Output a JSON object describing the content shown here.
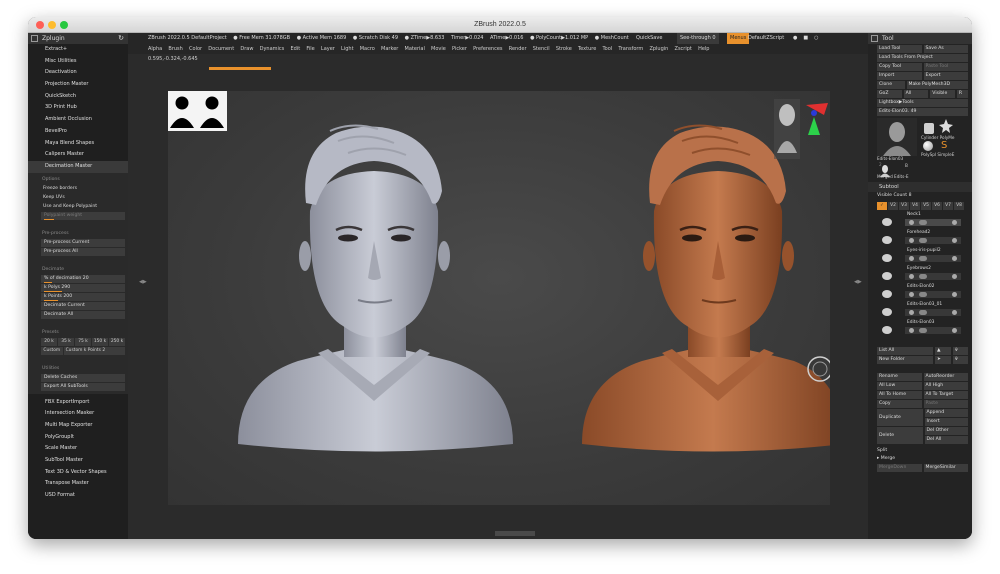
{
  "window": {
    "title": "ZBrush 2022.0.5"
  },
  "topinfo": {
    "project": "ZBrush 2022.0.5 DefaultProject",
    "free_mem": "● Free Mem 31.078GB",
    "active_mem": "● Active Mem 1689",
    "scratch_disk": "● Scratch Disk 49",
    "ztime": "● ZTime▶8.633",
    "timer": "Timer▶0.024",
    "atime": "ATime▶0.016",
    "polycount": "● PolyCount▶1.012 MP",
    "meshcount": "● MeshCount",
    "quicksave": "QuickSave",
    "see_through": "See-through 0",
    "menus": "Menus",
    "zscript": "DefaultZScript"
  },
  "menubar": [
    "Alpha",
    "Brush",
    "Color",
    "Document",
    "Draw",
    "Dynamics",
    "Edit",
    "File",
    "Layer",
    "Light",
    "Macro",
    "Marker",
    "Material",
    "Movie",
    "Picker",
    "Preferences",
    "Render",
    "Stencil",
    "Stroke",
    "Texture",
    "Tool",
    "Transform",
    "Zplugin",
    "Zscript",
    "Help"
  ],
  "coords": "0.595,-0.324,-0.645",
  "left_panel": {
    "title": "Zplugin",
    "items_top": [
      "Extract+",
      "Misc Utilities",
      "Deactivation",
      "Projection Master",
      "QuickSketch",
      "3D Print Hub",
      "Ambient Occlusion",
      "BevelPro",
      "Maya Blend Shapes",
      "Calipers Master",
      "Decimation Master"
    ],
    "decimation": {
      "options_head": "Options",
      "freeze_borders": "Freeze borders",
      "keep_uvs": "Keep UVs",
      "use_keep_polypaint": "Use and Keep Polypaint",
      "polypaint_weight": "Polypaint weight",
      "preprocess_head": "Pre-process",
      "preprocess_current": "Pre-process Current",
      "preprocess_all": "Pre-process All",
      "decimate_head": "Decimate",
      "pct_decimation": "% of decimation 20",
      "k_polys": "k Polys 290",
      "k_points": "k Points 200",
      "decimate_current": "Decimate Current",
      "decimate_all": "Decimate All",
      "presets_head": "Presets",
      "kpolys": [
        "20 k",
        "35 k",
        "75 k",
        "150 k",
        "250 k"
      ],
      "custom": "Custom",
      "custom_kpoints": "Custom k Points 2",
      "utilities_head": "Utilities",
      "delete_caches": "Delete Caches",
      "export_all": "Export All SubTools"
    },
    "items_bottom": [
      "FBX ExportImport",
      "Intersection Masker",
      "Multi Map Exporter",
      "PolyGroupIt",
      "Scale Master",
      "SubTool Master",
      "Text 3D & Vector Shapes",
      "Transpose Master",
      "USD Format"
    ]
  },
  "right_panel": {
    "title": "Tool",
    "load_tool": "Load Tool",
    "save_as": "Save As",
    "load_from_project": "Load Tools From Project",
    "copy_tool": "Copy Tool",
    "paste_tool": "Paste Tool",
    "import": "Import",
    "export": "Export",
    "clone": "Clone",
    "make_polymesh": "Make PolyMesh3D",
    "goz": "GoZ",
    "all": "All",
    "visible": "Visible",
    "r": "R",
    "lightbox_tools": "Lightbox▶Tools",
    "current_tool": "Edits-Elon03. 49",
    "thumb_labels": [
      "Edits-Elon03",
      "Cylinder PolyMe",
      "PolySpl SimpleE",
      "Merged Edits-E",
      "B"
    ],
    "thumb_num": "2",
    "subtool_head": "Subtool",
    "visible_count": "Visible Count 8",
    "v_buttons": [
      "V2",
      "V3",
      "V4",
      "V5",
      "V6",
      "V7",
      "V8"
    ],
    "subtools": [
      "Neck1",
      "Forehead2",
      "Eyes-iris-pupil2",
      "Eyebrows2",
      "Edits-Elon02",
      "Edits-Elon03_01",
      "Edits-Elon03"
    ],
    "list_all": "List All",
    "new_folder": "New Folder",
    "rename": "Rename",
    "autoreorder": "AutoReorder",
    "all_low": "All Low",
    "all_high": "All High",
    "all_to_home": "All To Home",
    "all_to_target": "All To Target",
    "copy": "Copy",
    "paste": "Paste",
    "duplicate": "Duplicate",
    "append": "Append",
    "insert": "Insert",
    "delete": "Delete",
    "del_other": "Del Other",
    "del_all": "Del All",
    "split": "Split",
    "merge": "▸ Merge",
    "merge_down": "MergeDown",
    "merge_similar": "MergeSimilar"
  }
}
